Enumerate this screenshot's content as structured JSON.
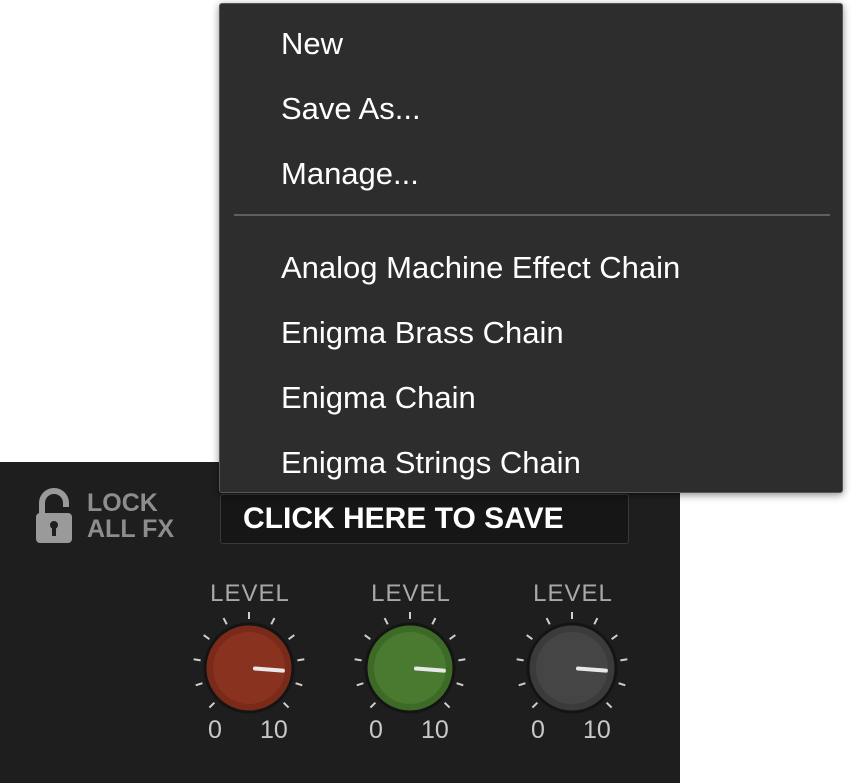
{
  "menu": {
    "items_top": [
      "New",
      "Save As...",
      "Manage..."
    ],
    "presets": [
      "Analog Machine Effect Chain",
      "Enigma Brass Chain",
      "Enigma Chain",
      "Enigma Strings Chain"
    ]
  },
  "lock": {
    "line1": "LOCK",
    "line2": "ALL FX",
    "icon": "unlocked-padlock-icon"
  },
  "save_button": {
    "label": "CLICK HERE TO SAVE"
  },
  "knobs": [
    {
      "label": "LEVEL",
      "min": "0",
      "max": "10",
      "color": "#7a2a18",
      "value_fraction": 0.85
    },
    {
      "label": "LEVEL",
      "min": "0",
      "max": "10",
      "color": "#3e6a28",
      "value_fraction": 0.85
    },
    {
      "label": "LEVEL",
      "min": "0",
      "max": "10",
      "color": "#3b3b3b",
      "value_fraction": 0.85
    }
  ],
  "colors": {
    "menu_bg": "#2d2d2d",
    "panel_bg": "#1e1e1e",
    "text": "#ffffff"
  }
}
